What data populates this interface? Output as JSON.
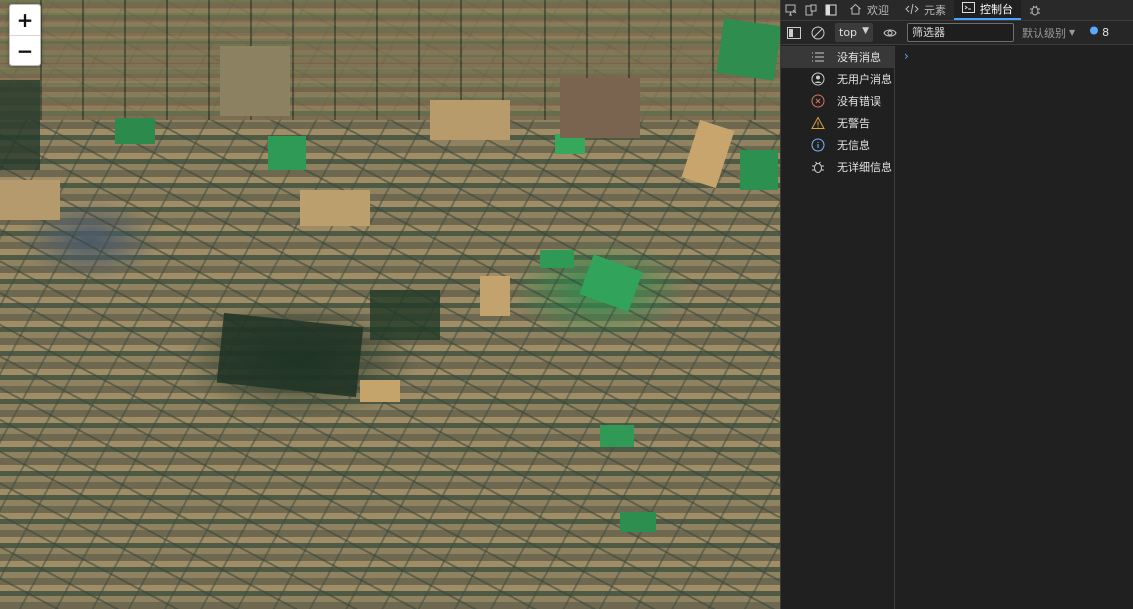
{
  "map": {
    "zoom_in_label": "+",
    "zoom_out_label": "−"
  },
  "devtools": {
    "tabs": [
      {
        "label": "欢迎",
        "icon": "home-icon"
      },
      {
        "label": "元素",
        "icon": "code-icon"
      },
      {
        "label": "控制台",
        "icon": "console-icon",
        "active": true
      }
    ],
    "toolbar": {
      "context": "top",
      "filter_placeholder": "筛选器",
      "levels_label": "默认级别",
      "issues_count": "8"
    },
    "sidebar": {
      "items": [
        {
          "label": "没有消息",
          "icon": "list-icon"
        },
        {
          "label": "无用户消息",
          "icon": "user-circle-icon"
        },
        {
          "label": "没有错误",
          "icon": "error-icon"
        },
        {
          "label": "无警告",
          "icon": "warning-icon"
        },
        {
          "label": "无信息",
          "icon": "info-icon"
        },
        {
          "label": "无详细信息",
          "icon": "bug-icon"
        }
      ]
    },
    "console_prompt": "›"
  },
  "colors": {
    "accent": "#4aa3ff",
    "panel_bg": "#202020",
    "tab_bg": "#292929"
  }
}
